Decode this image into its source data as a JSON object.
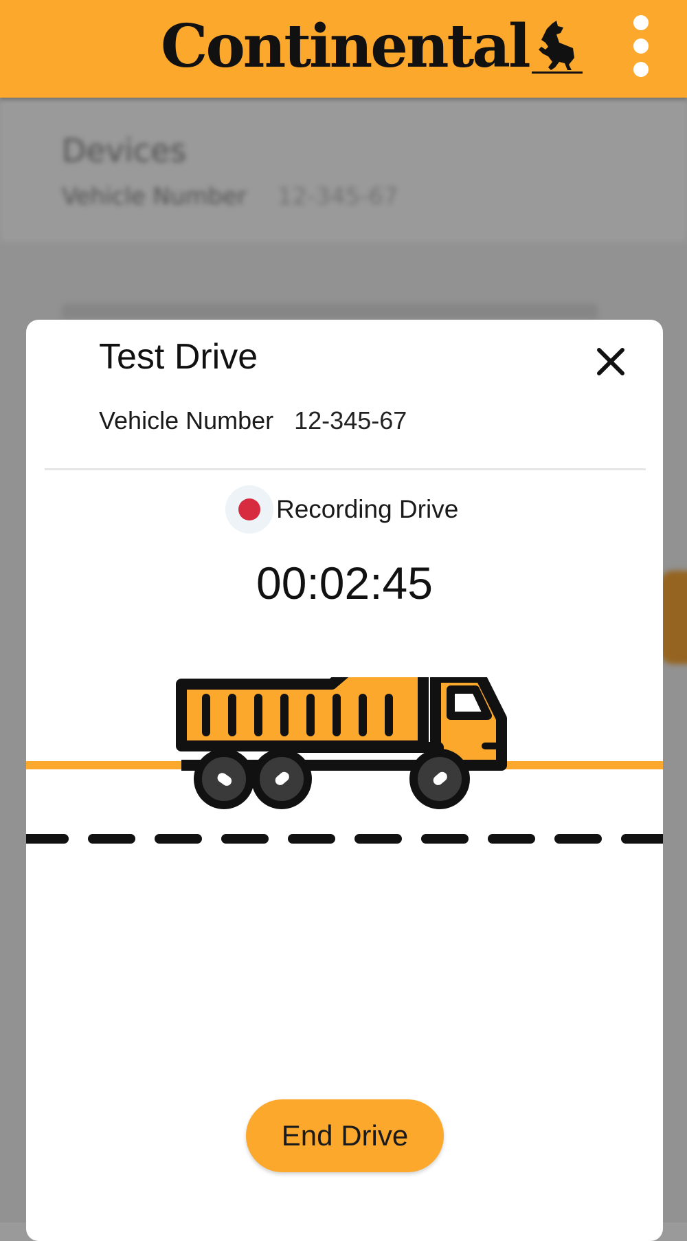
{
  "header": {
    "brand": "Continental",
    "menu_icon": "kebab-menu-icon",
    "accent_color": "#fca82d"
  },
  "background_page": {
    "title": "Devices",
    "vehicle_label": "Vehicle Number",
    "vehicle_value": "12-345-67"
  },
  "modal": {
    "title": "Test Drive",
    "close_icon": "close-icon",
    "vehicle_label": "Vehicle Number",
    "vehicle_value": "12-345-67",
    "status": {
      "icon": "recording-dot-icon",
      "text": "Recording Drive",
      "color": "#d72b3f"
    },
    "timer": "00:02:45",
    "illustration_icon": "dump-truck-icon",
    "end_button_label": "End Drive"
  }
}
